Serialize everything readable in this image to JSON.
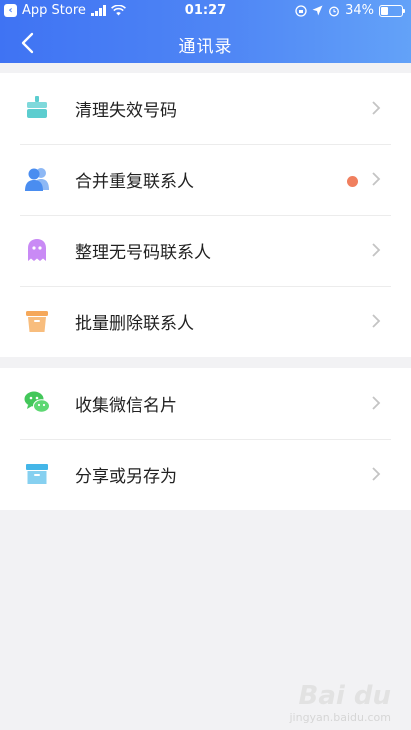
{
  "status_bar": {
    "back_app_label": "App Store",
    "time": "01:27",
    "battery_percent": "34%",
    "battery_level": 0.34
  },
  "header": {
    "title": "通讯录"
  },
  "groups": [
    {
      "items": [
        {
          "label": "清理失效号码",
          "icon": "broom-icon",
          "badge": false
        },
        {
          "label": "合并重复联系人",
          "icon": "people-icon",
          "badge": true
        },
        {
          "label": "整理无号码联系人",
          "icon": "ghost-icon",
          "badge": false
        },
        {
          "label": "批量删除联系人",
          "icon": "trash-icon",
          "badge": false
        }
      ]
    },
    {
      "items": [
        {
          "label": "收集微信名片",
          "icon": "wechat-icon",
          "badge": false
        },
        {
          "label": "分享或另存为",
          "icon": "archive-box-icon",
          "badge": false
        }
      ]
    }
  ],
  "colors": {
    "header_start": "#3f73f3",
    "header_end": "#63a2f8",
    "badge_dot": "#f07f5e",
    "icon_teal": "#5ccdcf",
    "icon_blue": "#4a8df0",
    "icon_purple": "#c98af5",
    "icon_orange": "#f5a85a",
    "icon_green": "#43c75a",
    "icon_cyan": "#44b6e8"
  },
  "watermark": {
    "brand": "Bai du",
    "site": "jingyan.baidu.com"
  }
}
